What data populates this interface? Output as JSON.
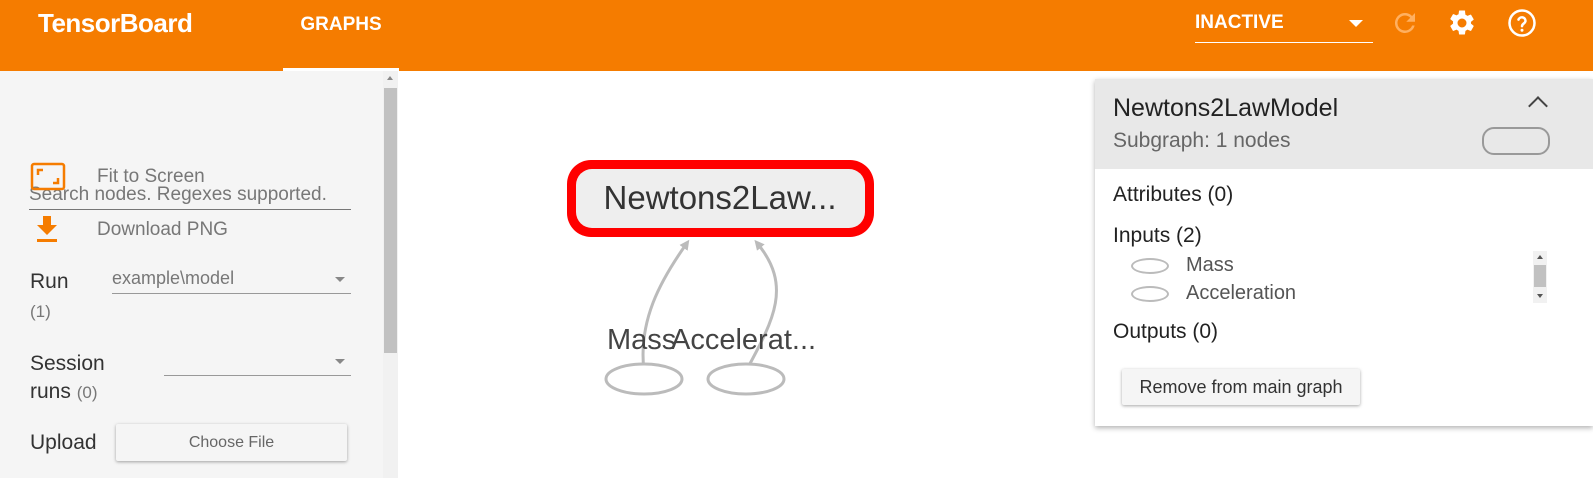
{
  "app": {
    "title": "TensorBoard"
  },
  "tabs": [
    {
      "label": "GRAPHS"
    }
  ],
  "toolbar": {
    "status": "INACTIVE",
    "icons": [
      "refresh-icon",
      "settings-icon",
      "help-icon"
    ]
  },
  "colors": {
    "header": "#f57c00",
    "selected_node": "#ff0000"
  },
  "sidebar": {
    "search_placeholder": "Search nodes. Regexes supported.",
    "fit_label": "Fit to Screen",
    "download_label": "Download PNG",
    "run_label": "Run",
    "run_count": "(1)",
    "run_value": "example\\model",
    "session_label_line1": "Session",
    "session_label_line2": "runs",
    "session_count": "(0)",
    "session_value": "",
    "upload_label": "Upload",
    "choose_file": "Choose File"
  },
  "graph": {
    "main_node": "Newtons2Law...",
    "input_nodes": [
      "Mass",
      "Accelerat..."
    ]
  },
  "info": {
    "title": "Newtons2LawModel",
    "subtitle": "Subgraph: 1 nodes",
    "attributes": "Attributes (0)",
    "inputs_header": "Inputs (2)",
    "inputs": [
      "Mass",
      "Acceleration"
    ],
    "outputs": "Outputs (0)",
    "remove_button": "Remove from main graph"
  }
}
